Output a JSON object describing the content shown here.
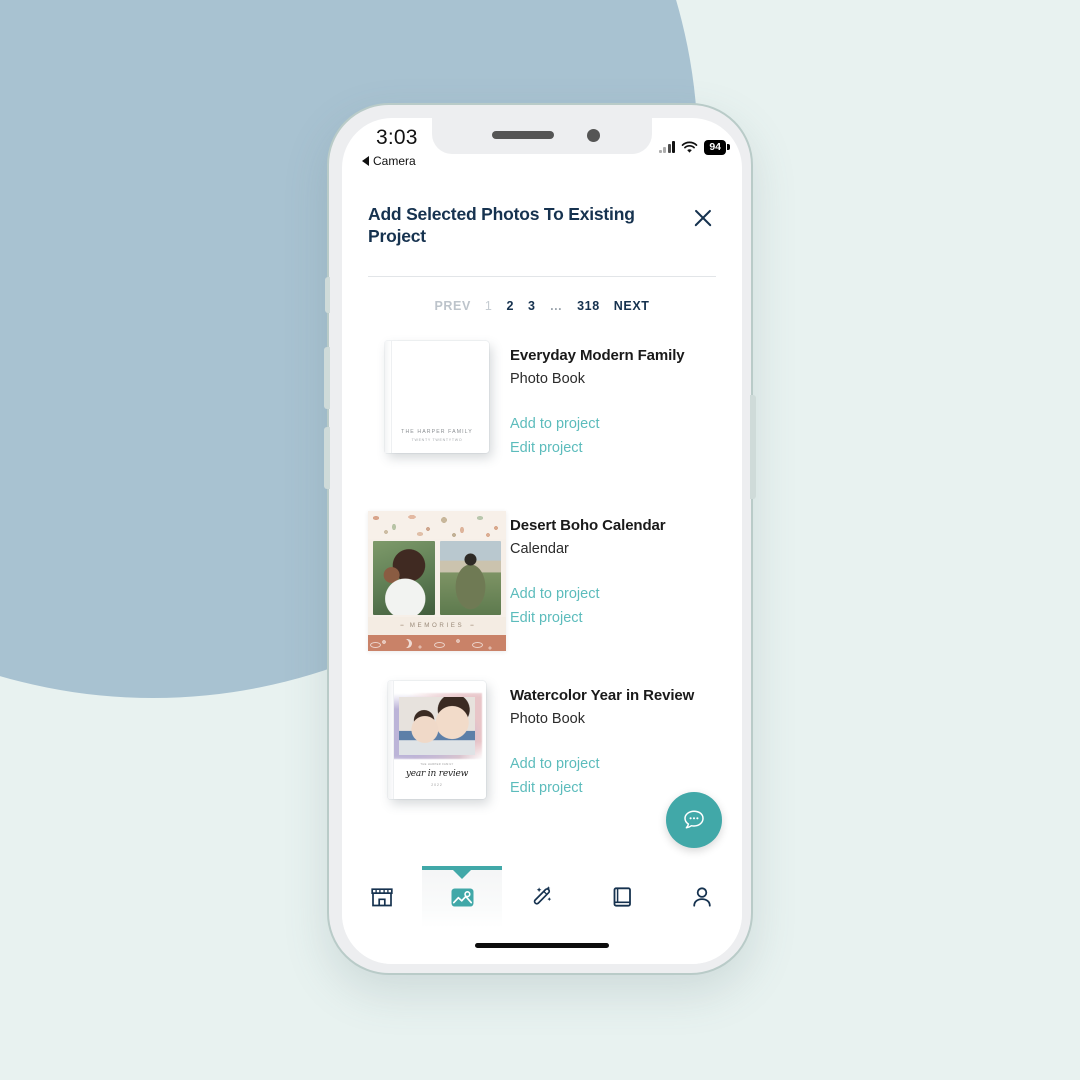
{
  "status_bar": {
    "time": "3:03",
    "back_label": "Camera",
    "battery_percent": "94",
    "wifi_icon": "wifi-icon",
    "signal_icon": "cellular-signal-icon"
  },
  "modal": {
    "title": "Add Selected Photos To Existing Project",
    "close_icon": "close-icon"
  },
  "pagination": {
    "prev_label": "PREV",
    "next_label": "NEXT",
    "pages": [
      "1",
      "2",
      "3",
      "…",
      "318"
    ],
    "active_page": "2"
  },
  "projects": [
    {
      "title": "Everyday Modern Family",
      "type": "Photo Book",
      "add_label": "Add to project",
      "edit_label": "Edit project",
      "thumbnail": {
        "kind": "white-photo-book",
        "cover_title": "THE HARPER FAMILY",
        "cover_subtitle": "TWENTY TWENTYTWO"
      }
    },
    {
      "title": "Desert Boho Calendar",
      "type": "Calendar",
      "add_label": "Add to project",
      "edit_label": "Edit project",
      "thumbnail": {
        "kind": "boho-calendar",
        "cover_title": "MEMORIES",
        "ornament_left": "••",
        "ornament_right": "••"
      }
    },
    {
      "title": "Watercolor Year in Review",
      "type": "Photo Book",
      "add_label": "Add to project",
      "edit_label": "Edit project",
      "thumbnail": {
        "kind": "watercolor-photo-book",
        "cover_caption": "THE HARPER FAMILY",
        "cover_script": "year in review",
        "cover_year": "2022"
      }
    }
  ],
  "chat_fab": {
    "icon": "chat-bubble-icon"
  },
  "tabbar": {
    "items": [
      {
        "icon": "storefront-icon",
        "active": false
      },
      {
        "icon": "photos-icon",
        "active": true
      },
      {
        "icon": "magic-wand-icon",
        "active": false
      },
      {
        "icon": "book-icon",
        "active": false
      },
      {
        "icon": "profile-icon",
        "active": false
      }
    ]
  },
  "colors": {
    "accent_teal": "#41a8a8",
    "link_teal": "#5cbcbc",
    "title_navy": "#16324f",
    "background_mint": "#e8f2f0",
    "background_blue": "#a8c2d1"
  }
}
